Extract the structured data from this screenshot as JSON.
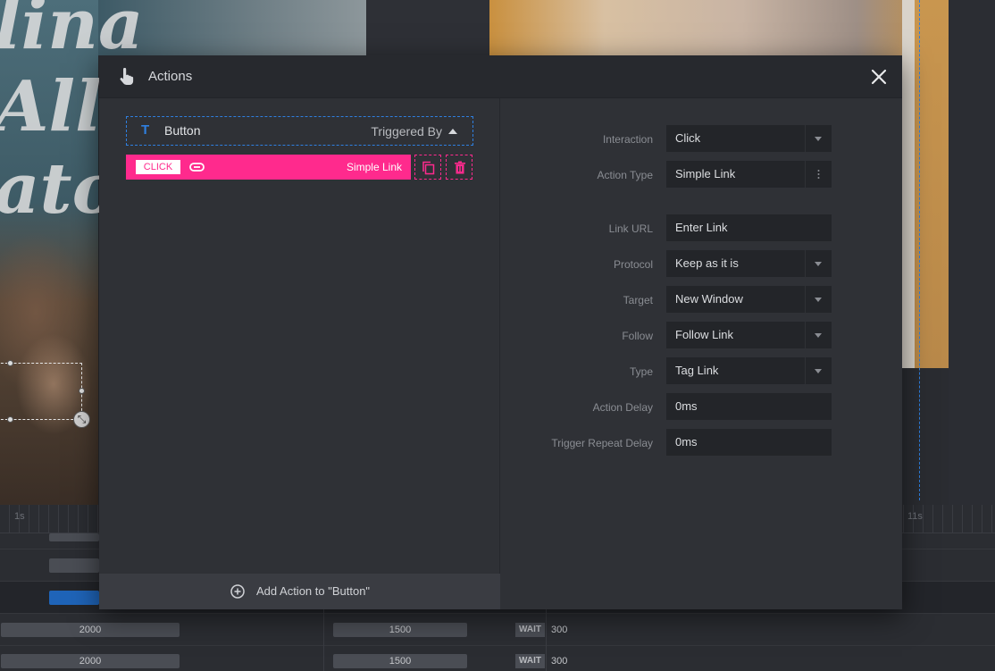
{
  "modal": {
    "title": "Actions",
    "close_label": "✕"
  },
  "trigger": {
    "name": "Button",
    "triggered_by_label": "Triggered By"
  },
  "action": {
    "event_tag": "CLICK",
    "type_label": "Simple Link"
  },
  "add_action_label": "Add Action to \"Button\"",
  "fields": [
    {
      "label": "Interaction",
      "value": "Click",
      "control": "dropdown"
    },
    {
      "label": "Action Type",
      "value": "Simple Link",
      "control": "menu"
    },
    {
      "label": "Link URL",
      "value": "Enter Link",
      "control": "text"
    },
    {
      "label": "Protocol",
      "value": "Keep as it is",
      "control": "dropdown"
    },
    {
      "label": "Target",
      "value": "New Window",
      "control": "dropdown"
    },
    {
      "label": "Follow",
      "value": "Follow Link",
      "control": "dropdown"
    },
    {
      "label": "Type",
      "value": "Tag Link",
      "control": "dropdown"
    },
    {
      "label": "Action Delay",
      "value": "0ms",
      "control": "text"
    },
    {
      "label": "Trigger Repeat Delay",
      "value": "0ms",
      "control": "text"
    }
  ],
  "background": {
    "script_text": "lina\nAll\nator"
  },
  "timeline": {
    "ruler_labels": [
      "1s",
      "11s"
    ],
    "rows": [
      {
        "duration": "2000",
        "duration2": "1500",
        "wait_label": "WAIT",
        "wait_value": "300"
      },
      {
        "duration": "2000",
        "duration2": "1500",
        "wait_label": "WAIT",
        "wait_value": "300"
      }
    ]
  },
  "colors": {
    "accent_pink": "#ff2a8d",
    "accent_blue": "#2f7fe0",
    "modal_bg": "#2f3136",
    "header_bg": "#27292e",
    "field_bg": "#232529"
  },
  "icons": {
    "header": "hand-pointer-icon",
    "trigger": "text-t-icon",
    "link": "link-icon",
    "duplicate": "duplicate-icon",
    "delete": "trash-icon",
    "add": "plus-circle-icon",
    "close": "close-icon"
  }
}
